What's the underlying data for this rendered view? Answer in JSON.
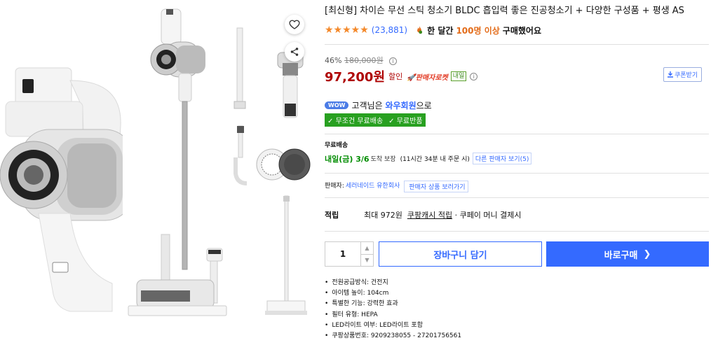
{
  "product": {
    "title": "[최신형] 차이슨 무선 스틱 청소기 BLDC 흡입력 좋은 진공청소기 + 다양한 구성품 + 평생 AS",
    "stars": "★★★★★",
    "rating": 5,
    "review_count": "(23,881)",
    "purchase_prefix": "한 달간",
    "purchase_count": "100명 이상",
    "purchase_suffix": "구매했어요"
  },
  "price": {
    "discount_rate": "46%",
    "original_price": "180,000원",
    "sale_price": "97,200원",
    "sale_label": "할인",
    "rocket_label": "판매자로켓",
    "tomorrow_tag": "내일",
    "coupon_label": "쿠폰받기"
  },
  "membership": {
    "wow_badge": "WOW",
    "text_prefix": "고객님은",
    "member_name": "와우회원",
    "text_suffix": "으로",
    "benefit_free_shipping": "무조건 무료배송",
    "benefit_free_return": "무료반품"
  },
  "shipping": {
    "title": "무료배송",
    "arrival_date": "내일(금) 3/6",
    "arrival_suffix": "도착 보장",
    "deadline": "(11시간 34분 내 주문 시)",
    "other_sellers": "다른 판매자 보기(5)"
  },
  "seller": {
    "label": "판매자:",
    "name": "세러네이드 유한회사",
    "link": "판매자 상품 보러가기"
  },
  "points": {
    "label": "적립",
    "text_prefix": "최대 972원",
    "link": "쿠팡캐시 적립",
    "text_suffix": "· 쿠페이 머니 결제시"
  },
  "purchase": {
    "quantity": "1",
    "cart_label": "장바구니 담기",
    "buy_label": "바로구매"
  },
  "specs": [
    "전원공급방식: 건전지",
    "아이템 높이: 104cm",
    "특별한 기능: 강력한 효과",
    "필터 유형: HEPA",
    "LED라이트 여부: LED라이트 포함",
    "쿠팡상품번호: 9209238055 - 27201756561"
  ],
  "icons": {
    "wishlist": "heart-icon",
    "share": "share-icon",
    "coupon": "download-icon",
    "info": "info-icon",
    "buy_now": "chevron-right-icon"
  },
  "colors": {
    "accent": "#346aff",
    "price": "#ae0000",
    "rating": "#f4892b",
    "benefit": "#28a020"
  }
}
